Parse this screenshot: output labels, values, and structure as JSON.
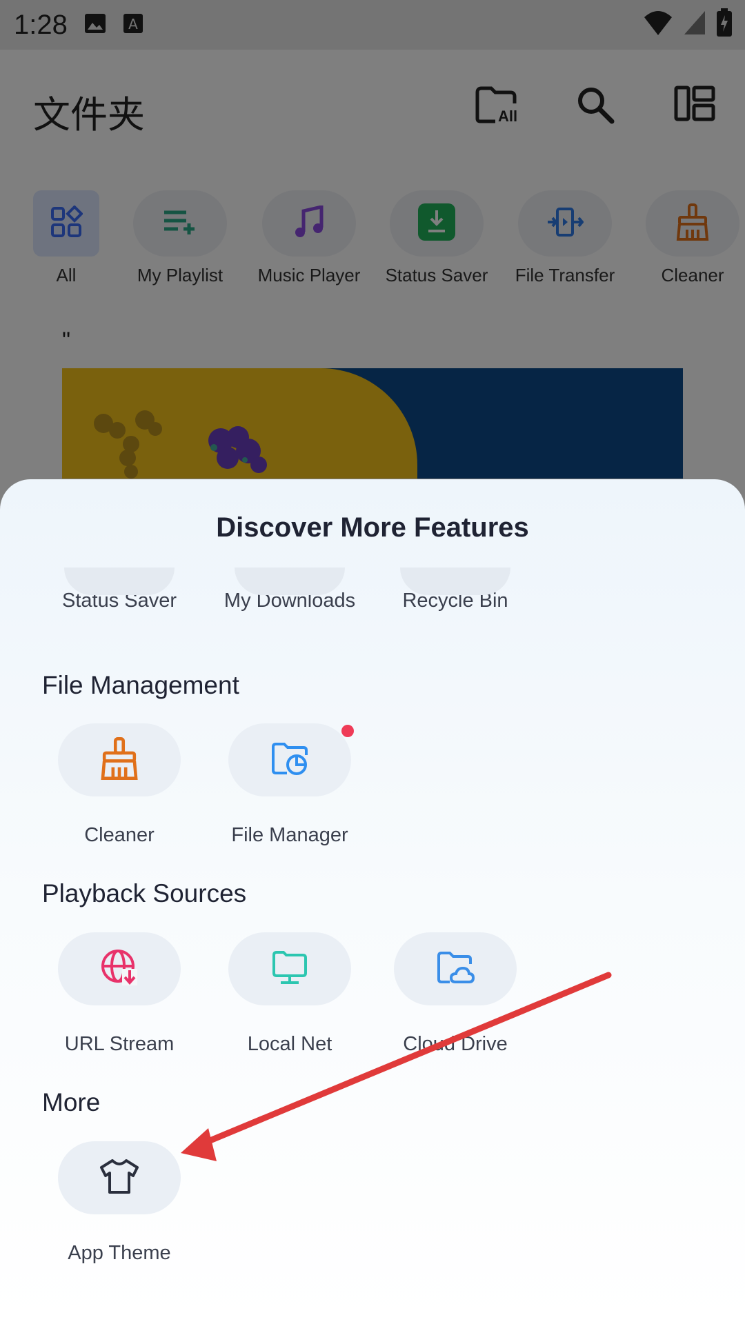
{
  "status_bar": {
    "time": "1:28",
    "icons": [
      "image-icon",
      "font-icon",
      "wifi-icon",
      "signal-icon",
      "battery-icon"
    ]
  },
  "app_bar": {
    "title": "文件夹",
    "actions": [
      "folder-all-icon",
      "search-icon",
      "layout-icon"
    ],
    "all_badge": "All"
  },
  "quick_access": [
    {
      "label": "All",
      "icon": "grid-icon"
    },
    {
      "label": "My Playlist",
      "icon": "playlist-add-icon"
    },
    {
      "label": "Music Player",
      "icon": "music-note-icon"
    },
    {
      "label": "Status Saver",
      "icon": "download-icon"
    },
    {
      "label": "File Transfer",
      "icon": "transfer-icon"
    },
    {
      "label": "Cleaner",
      "icon": "broom-icon"
    }
  ],
  "feed": {
    "quote_mark": "\""
  },
  "sheet": {
    "title": "Discover More Features",
    "top_row": [
      {
        "label": "Status Saver"
      },
      {
        "label": "My Downloads"
      },
      {
        "label": "Recycle Bin"
      }
    ],
    "sections": [
      {
        "title": "File Management",
        "items": [
          {
            "label": "Cleaner",
            "icon": "broom-icon",
            "color": "#e0701a"
          },
          {
            "label": "File Manager",
            "icon": "folder-chart-icon",
            "color": "#2f8ff0",
            "badge": true
          }
        ]
      },
      {
        "title": "Playback Sources",
        "items": [
          {
            "label": "URL Stream",
            "icon": "globe-download-icon",
            "color": "#e8326a"
          },
          {
            "label": "Local Net",
            "icon": "monitor-folder-icon",
            "color": "#2cc6b0"
          },
          {
            "label": "Cloud Drive",
            "icon": "cloud-folder-icon",
            "color": "#3a8ee8"
          }
        ]
      },
      {
        "title": "More",
        "items": [
          {
            "label": "App Theme",
            "icon": "tshirt-icon",
            "color": "#2a2f3d"
          }
        ]
      }
    ]
  },
  "colors": {
    "accent_red": "#e03a3a",
    "badge_red": "#ef3b57"
  }
}
